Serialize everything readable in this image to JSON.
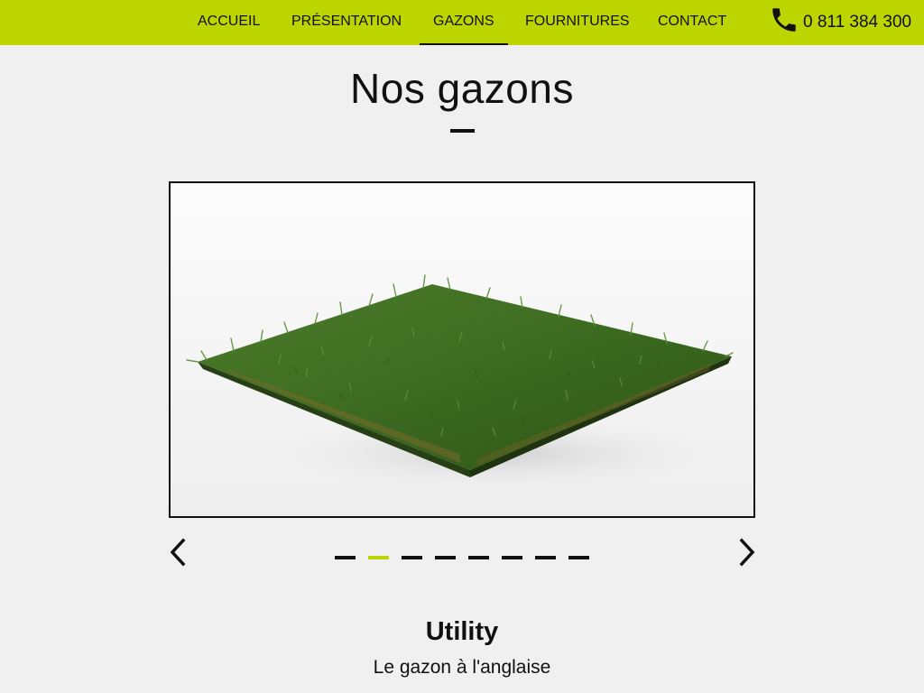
{
  "nav": {
    "items": [
      {
        "label": "ACCUEIL"
      },
      {
        "label": "PRÉSENTATION"
      },
      {
        "label": "GAZONS"
      },
      {
        "label": "FOURNITURES"
      },
      {
        "label": "CONTACT"
      }
    ],
    "active": "GAZONS",
    "phone": "0 811 384 300",
    "phone_icon": "phone-icon"
  },
  "main": {
    "title": "Nos gazons"
  },
  "slider": {
    "image": "artificial-grass-sample",
    "slide_count": 8,
    "active_index": 1,
    "prev_icon": "chevron-left-icon",
    "next_icon": "chevron-right-icon"
  },
  "product": {
    "name": "Utility",
    "subtitle": "Le gazon à l'anglaise"
  },
  "colors": {
    "brand": "#bcd400",
    "background": "#f0f0f0",
    "text": "#111111"
  }
}
